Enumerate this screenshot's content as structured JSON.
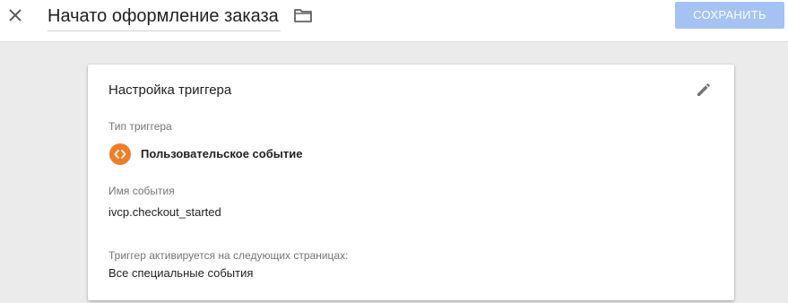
{
  "header": {
    "title": "Начато оформление заказа",
    "save_label": "СОХРАНИТЬ",
    "close_icon": "close-icon",
    "folder_icon": "folder-icon"
  },
  "card": {
    "title": "Настройка триггера",
    "edit_icon": "pencil-icon",
    "trigger_type_label": "Тип триггера",
    "trigger_type_value": "Пользовательское событие",
    "trigger_type_icon": "custom-event-icon",
    "event_name_label": "Имя события",
    "event_name_value": "ivcp.checkout_started",
    "fires_on_label": "Триггер активируется на следующих страницах:",
    "fires_on_value": "Все специальные события"
  },
  "colors": {
    "accent_orange": "#f07e26",
    "save_button_disabled": "#a4c2f4",
    "background": "#ebebeb"
  }
}
